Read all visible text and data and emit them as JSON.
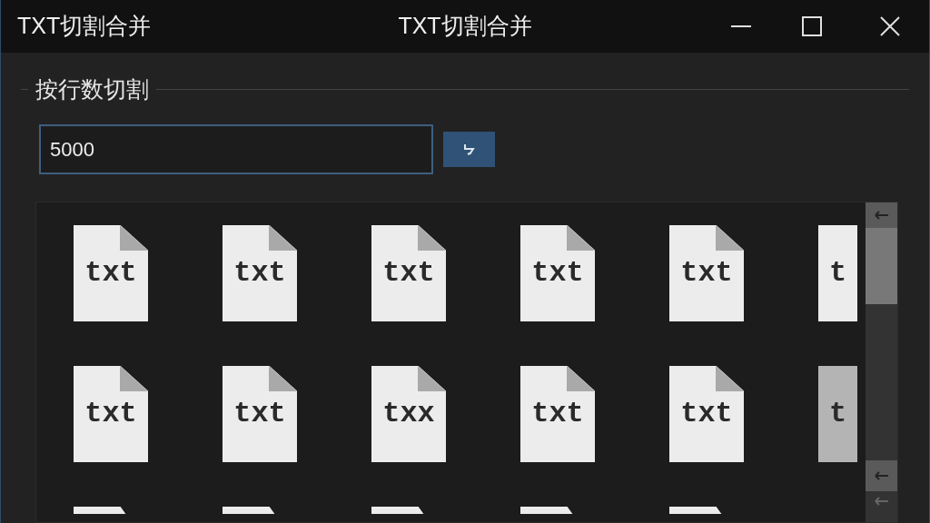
{
  "window": {
    "app_name": "TXT切割合并",
    "title": "TXT切割合并"
  },
  "group": {
    "title": "按行数切割",
    "line_count": {
      "value": "5000"
    }
  },
  "tile_rows": [
    [
      {
        "kind": "full",
        "label": "txt",
        "selected": false
      },
      {
        "kind": "full",
        "label": "txt",
        "selected": false
      },
      {
        "kind": "full",
        "label": "txt",
        "selected": false
      },
      {
        "kind": "full",
        "label": "txt",
        "selected": false
      },
      {
        "kind": "full",
        "label": "txt",
        "selected": false
      },
      {
        "kind": "cut",
        "label": "t",
        "selected": false
      }
    ],
    [
      {
        "kind": "full",
        "label": "txt",
        "selected": false
      },
      {
        "kind": "full",
        "label": "txt",
        "selected": false
      },
      {
        "kind": "full",
        "label": "txx",
        "selected": false
      },
      {
        "kind": "full",
        "label": "txt",
        "selected": false
      },
      {
        "kind": "full",
        "label": "txt",
        "selected": false
      },
      {
        "kind": "cut",
        "label": "t",
        "selected": true
      }
    ],
    [
      {
        "kind": "top",
        "selected": false
      },
      {
        "kind": "top",
        "selected": false
      },
      {
        "kind": "top",
        "selected": false
      },
      {
        "kind": "top",
        "selected": false
      },
      {
        "kind": "top",
        "selected": false
      }
    ]
  ]
}
